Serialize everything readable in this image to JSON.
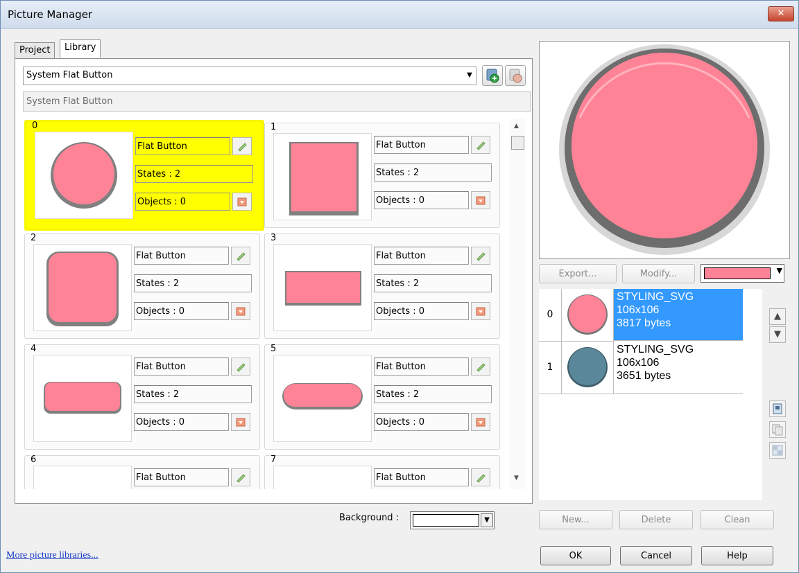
{
  "window": {
    "title": "Picture Manager",
    "close_label": "✕"
  },
  "tabs": [
    {
      "label": "Project"
    },
    {
      "label": "Library"
    }
  ],
  "library": {
    "selected": "System Flat Button",
    "description": "System Flat Button"
  },
  "pictures": [
    {
      "index": "0",
      "name": "Flat Button",
      "states": "States : 2",
      "objects": "Objects : 0"
    },
    {
      "index": "1",
      "name": "Flat Button",
      "states": "States : 2",
      "objects": "Objects : 0"
    },
    {
      "index": "2",
      "name": "Flat Button",
      "states": "States : 2",
      "objects": "Objects : 0"
    },
    {
      "index": "3",
      "name": "Flat Button",
      "states": "States : 2",
      "objects": "Objects : 0"
    },
    {
      "index": "4",
      "name": "Flat Button",
      "states": "States : 2",
      "objects": "Objects : 0"
    },
    {
      "index": "5",
      "name": "Flat Button",
      "states": "States : 2",
      "objects": "Objects : 0"
    },
    {
      "index": "6",
      "name": "Flat Button"
    },
    {
      "index": "7",
      "name": "Flat Button"
    }
  ],
  "preview_buttons": {
    "export": "Export...",
    "modify": "Modify..."
  },
  "accent_color": "#ff8396",
  "states": [
    {
      "index": "0",
      "type": "STYLING_SVG",
      "size": "106x106",
      "bytes": "3817 bytes",
      "color": "#ff8396"
    },
    {
      "index": "1",
      "type": "STYLING_SVG",
      "size": "106x106",
      "bytes": "3651 bytes",
      "color": "#5a8799"
    }
  ],
  "state_buttons": {
    "new": "New...",
    "delete": "Delete",
    "clean": "Clean"
  },
  "background_label": "Background :",
  "footer": {
    "link": "More picture libraries...",
    "ok": "OK",
    "cancel": "Cancel",
    "help": "Help"
  }
}
